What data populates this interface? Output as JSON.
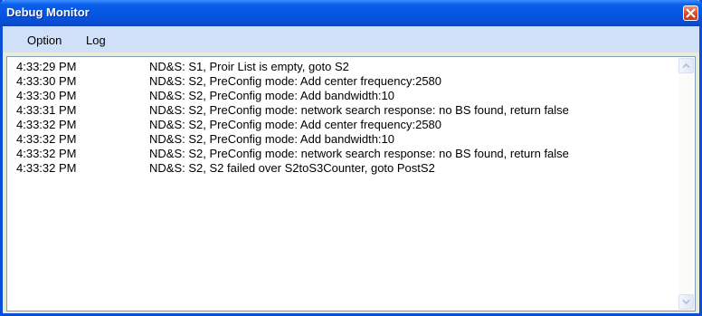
{
  "window": {
    "title": "Debug Monitor"
  },
  "menu": {
    "option_label": "Option",
    "log_label": "Log"
  },
  "log": {
    "entries": [
      {
        "time": "4:33:29 PM",
        "message": "ND&S: S1, Proir List is empty, goto S2"
      },
      {
        "time": "4:33:30 PM",
        "message": "ND&S: S2, PreConfig mode: Add center frequency:2580"
      },
      {
        "time": "4:33:30 PM",
        "message": "ND&S: S2, PreConfig mode: Add bandwidth:10"
      },
      {
        "time": "4:33:31 PM",
        "message": "ND&S: S2, PreConfig mode: network search response: no BS found, return false"
      },
      {
        "time": "4:33:32 PM",
        "message": "ND&S: S2, PreConfig mode: Add center frequency:2580"
      },
      {
        "time": "4:33:32 PM",
        "message": "ND&S: S2, PreConfig mode: Add bandwidth:10"
      },
      {
        "time": "4:33:32 PM",
        "message": "ND&S: S2, PreConfig mode: network search response: no BS found, return false"
      },
      {
        "time": "4:33:32 PM",
        "message": "ND&S: S2, S2 failed over S2toS3Counter, goto PostS2"
      }
    ]
  },
  "icons": {
    "close": "close-icon",
    "scroll_up": "chevron-up-icon",
    "scroll_down": "chevron-down-icon"
  },
  "colors": {
    "titlebar": "#0554e3",
    "menubar": "#cfe0f8",
    "close_button": "#e04a22"
  }
}
